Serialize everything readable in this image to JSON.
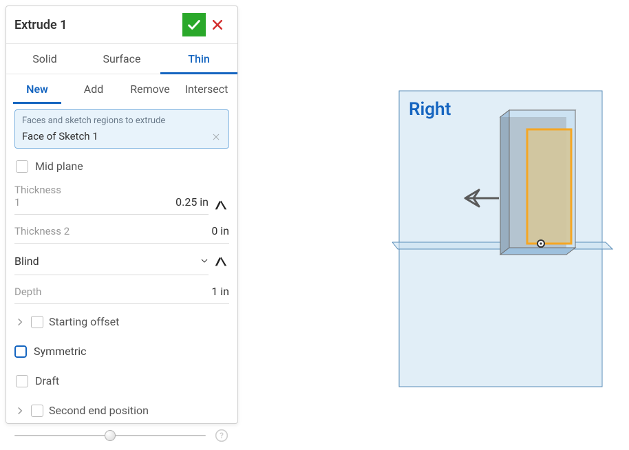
{
  "header": {
    "title": "Extrude 1"
  },
  "primaryTabs": {
    "t0": "Solid",
    "t1": "Surface",
    "t2": "Thin"
  },
  "secondaryTabs": {
    "t0": "New",
    "t1": "Add",
    "t2": "Remove",
    "t3": "Intersect"
  },
  "selection": {
    "label": "Faces and sketch regions to extrude",
    "value": "Face of Sketch 1"
  },
  "midPlane": "Mid plane",
  "thickness1": {
    "label": "Thickness 1",
    "value": "0.25 in"
  },
  "thickness2": {
    "label": "Thickness 2",
    "value": "0 in"
  },
  "endType": "Blind",
  "depth": {
    "label": "Depth",
    "value": "1 in"
  },
  "startingOffset": "Starting offset",
  "symmetric": "Symmetric",
  "draft": "Draft",
  "secondEnd": "Second end position",
  "viewport": {
    "planeLabel": "Right"
  }
}
